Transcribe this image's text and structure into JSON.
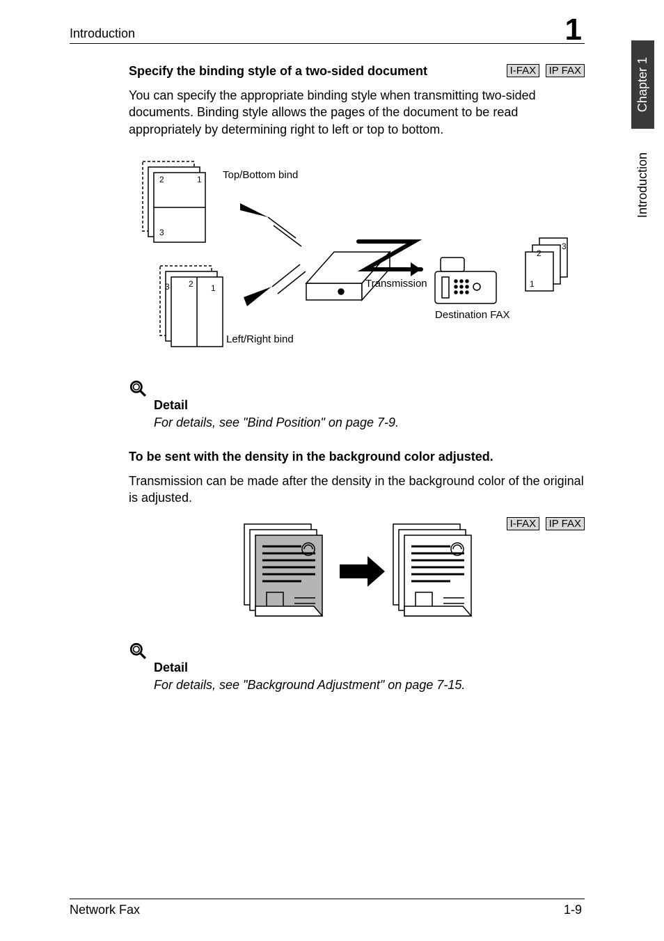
{
  "header": {
    "section": "Introduction",
    "chapterNumber": "1"
  },
  "sidetabs": {
    "chapter": "Chapter 1",
    "title": "Introduction"
  },
  "section1": {
    "heading": "Specify the binding style of a two-sided document",
    "badges": {
      "ifax": "I-FAX",
      "ipfax": "IP FAX"
    },
    "para": "You can specify the appropriate binding style when transmitting two-sided documents. Binding style allows the pages of the document to be read appropriately by determining right to left or top to bottom.",
    "figure": {
      "topBottom": "Top/Bottom bind",
      "leftRight": "Left/Right bind",
      "transmission": "Transmission",
      "destination": "Destination FAX",
      "n1": "1",
      "n2": "2",
      "n3": "3"
    },
    "detailLabel": "Detail",
    "detailText": "For details, see \"Bind Position\" on page 7-9."
  },
  "section2": {
    "heading": "To be sent with the density in the background color adjusted.",
    "para": "Transmission can be made after the density in the background color of the original is adjusted.",
    "badges": {
      "ifax": "I-FAX",
      "ipfax": "IP FAX"
    },
    "detailLabel": "Detail",
    "detailText": "For details, see \"Background Adjustment\" on page 7-15."
  },
  "footer": {
    "left": "Network Fax",
    "right": "1-9"
  }
}
